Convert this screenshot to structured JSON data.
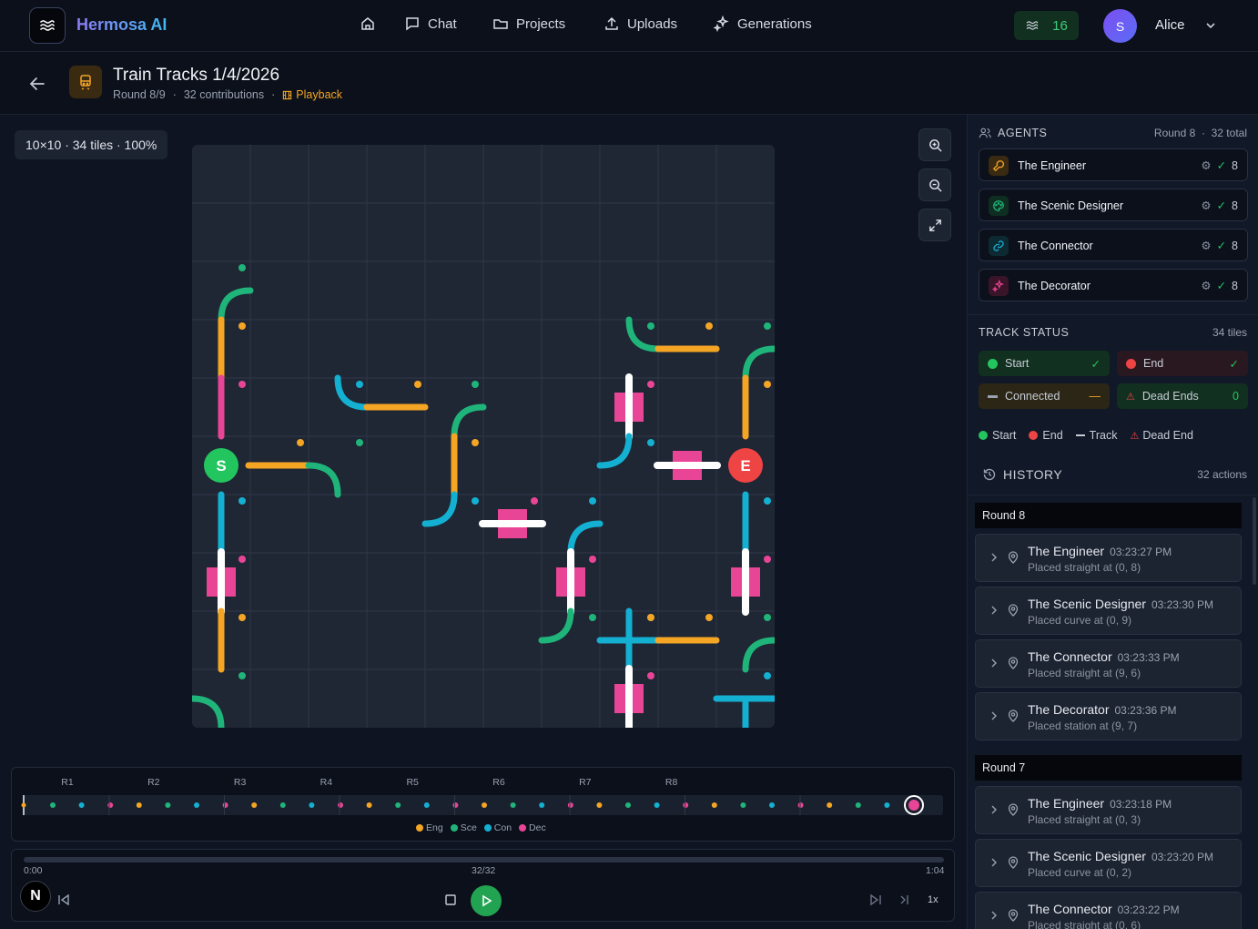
{
  "app": {
    "brand": "Hermosa AI",
    "nav": [
      {
        "label": "",
        "icon": "home-icon"
      },
      {
        "label": "Chat",
        "icon": "chat-icon"
      },
      {
        "label": "Projects",
        "icon": "folder-icon"
      },
      {
        "label": "Uploads",
        "icon": "upload-icon"
      },
      {
        "label": "Generations",
        "icon": "sparkles-icon"
      }
    ],
    "credits": "16",
    "user": {
      "initial": "S",
      "name": "Alice"
    }
  },
  "project": {
    "title": "Train Tracks 1/4/2026",
    "round": "Round 8/9",
    "contributions": "32 contributions",
    "playback": "Playback"
  },
  "board": {
    "info": "10×10 · 34 tiles · 100%",
    "start_label": "S",
    "end_label": "E",
    "colors": {
      "engineer": "#f4a524",
      "scenic": "#1fb57a",
      "connector": "#14b0d2",
      "decorator": "#e84596",
      "rail": "#ffffff",
      "start": "#22c55e",
      "end": "#ef4444"
    }
  },
  "timeline": {
    "rounds": [
      "R1",
      "R2",
      "R3",
      "R4",
      "R5",
      "R6",
      "R7",
      "R8"
    ],
    "legend": [
      {
        "label": "Eng",
        "color": "#f4a524"
      },
      {
        "label": "Sce",
        "color": "#1fb57a"
      },
      {
        "label": "Con",
        "color": "#14b0d2"
      },
      {
        "label": "Dec",
        "color": "#e84596"
      }
    ]
  },
  "player": {
    "start_time": "0:00",
    "end_time": "1:04",
    "counter": "32/32",
    "speed": "1x",
    "badge": "N"
  },
  "agents": {
    "heading": "AGENTS",
    "round": "Round 8",
    "total": "32 total",
    "list": [
      {
        "name": "The Engineer",
        "count": "8",
        "icon": "wrench-icon",
        "color": "#f4a524",
        "bg": "#3a2a12"
      },
      {
        "name": "The Scenic Designer",
        "count": "8",
        "icon": "palette-icon",
        "color": "#1fb57a",
        "bg": "#0f2e22"
      },
      {
        "name": "The Connector",
        "count": "8",
        "icon": "link-icon",
        "color": "#14b0d2",
        "bg": "#0d2a33"
      },
      {
        "name": "The Decorator",
        "count": "8",
        "icon": "sparkles-icon",
        "color": "#e84596",
        "bg": "#3a1428"
      }
    ]
  },
  "track_status": {
    "heading": "TRACK STATUS",
    "tiles": "34 tiles",
    "start": "Start",
    "end": "End",
    "connected": "Connected",
    "dead_ends": "Dead Ends",
    "dead_ends_count": "0",
    "legend": [
      "Start",
      "End",
      "Track",
      "Dead End"
    ]
  },
  "history": {
    "heading": "HISTORY",
    "actions": "32 actions",
    "rounds": [
      {
        "label": "Round 8",
        "items": [
          {
            "who": "The Engineer",
            "time": "03:23:27 PM",
            "action": "Placed straight at (0, 8)"
          },
          {
            "who": "The Scenic Designer",
            "time": "03:23:30 PM",
            "action": "Placed curve at (0, 9)"
          },
          {
            "who": "The Connector",
            "time": "03:23:33 PM",
            "action": "Placed straight at (9, 6)"
          },
          {
            "who": "The Decorator",
            "time": "03:23:36 PM",
            "action": "Placed station at (9, 7)"
          }
        ]
      },
      {
        "label": "Round 7",
        "items": [
          {
            "who": "The Engineer",
            "time": "03:23:18 PM",
            "action": "Placed straight at (0, 3)"
          },
          {
            "who": "The Scenic Designer",
            "time": "03:23:20 PM",
            "action": "Placed curve at (0, 2)"
          },
          {
            "who": "The Connector",
            "time": "03:23:22 PM",
            "action": "Placed straight at (0, 6)"
          }
        ]
      }
    ]
  }
}
